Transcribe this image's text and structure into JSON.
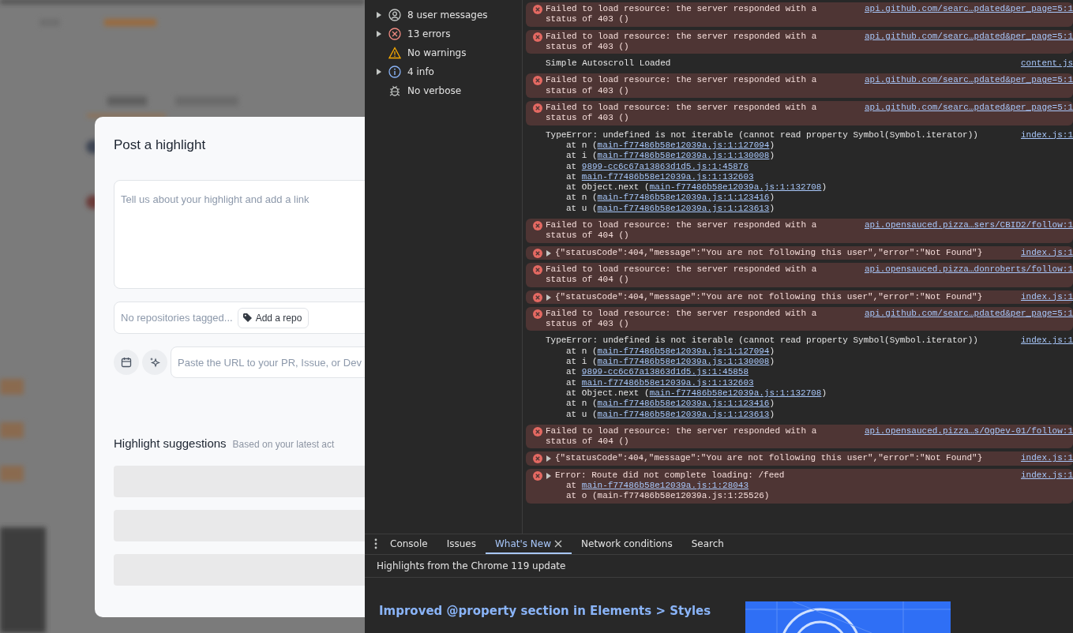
{
  "modal": {
    "title": "Post a highlight",
    "post_field": {
      "placeholder": "Tell us about your highlight and add a link"
    },
    "repo_field": {
      "placeholder": "No repositories tagged..."
    },
    "add_repo_button": "Add a repo",
    "url_field": {
      "placeholder": "Paste the URL to your PR, Issue, or Dev"
    },
    "suggestions": {
      "title": "Highlight suggestions",
      "subtitle": "Based on your latest act",
      "rows": [
        {
          "kind": "skeleton"
        },
        {
          "kind": "skeleton"
        },
        {
          "kind": "skeleton"
        }
      ]
    }
  },
  "sidebar": {
    "items": [
      {
        "label": "8 user messages",
        "kind": "user",
        "expandable": true
      },
      {
        "label": "13 errors",
        "kind": "error",
        "expandable": true
      },
      {
        "label": "No warnings",
        "kind": "warning",
        "expandable": false
      },
      {
        "label": "4 info",
        "kind": "info",
        "expandable": true
      },
      {
        "label": "No verbose",
        "kind": "verbose",
        "expandable": false
      }
    ]
  },
  "console": {
    "messages": [
      {
        "kind": "error",
        "expandable": false,
        "text": "Failed to load resource: the server responded with a status of 403 ()",
        "source": "api.github.com/searc…pdated&per_page=5:1"
      },
      {
        "kind": "error",
        "expandable": false,
        "text": "Failed to load resource: the server responded with a status of 403 ()",
        "source": "api.github.com/searc…pdated&per_page=5:1"
      },
      {
        "kind": "log",
        "expandable": false,
        "text": "Simple Autoscroll Loaded",
        "source": "content.js"
      },
      {
        "kind": "error",
        "expandable": false,
        "text": "Failed to load resource: the server responded with a status of 403 ()",
        "source": "api.github.com/searc…pdated&per_page=5:1"
      },
      {
        "kind": "error",
        "expandable": false,
        "text": "Failed to load resource: the server responded with a status of 403 ()",
        "source": "api.github.com/searc…pdated&per_page=5:1"
      },
      {
        "kind": "log",
        "expandable": false,
        "text": "TypeError: undefined is not iterable (cannot read property Symbol(Symbol.iterator))",
        "source": "index.js:1",
        "stack": [
          {
            "prefix": "at n (",
            "link": "main-f77486b58e12039a.js:1:127094",
            "suffix": ")"
          },
          {
            "prefix": "at i (",
            "link": "main-f77486b58e12039a.js:1:130008",
            "suffix": ")"
          },
          {
            "prefix": "at ",
            "link": "9899-cc6c67a13863d1d5.js:1:45876"
          },
          {
            "prefix": "at ",
            "link": "main-f77486b58e12039a.js:1:132603"
          },
          {
            "prefix": "at Object.next (",
            "link": "main-f77486b58e12039a.js:1:132708",
            "suffix": ")"
          },
          {
            "prefix": "at n (",
            "link": "main-f77486b58e12039a.js:1:123416",
            "suffix": ")"
          },
          {
            "prefix": "at u (",
            "link": "main-f77486b58e12039a.js:1:123613",
            "suffix": ")"
          }
        ]
      },
      {
        "kind": "error",
        "expandable": false,
        "text": "Failed to load resource: the server responded with a status of 404 ()",
        "source": "api.opensauced.pizza…sers/CBID2/follow:1"
      },
      {
        "kind": "error",
        "expandable": true,
        "text": "{\"statusCode\":404,\"message\":\"You are not following this user\",\"error\":\"Not Found\"}",
        "source": "index.js:1"
      },
      {
        "kind": "error",
        "expandable": false,
        "text": "Failed to load resource: the server responded with a status of 404 ()",
        "source": "api.opensauced.pizza…donroberts/follow:1"
      },
      {
        "kind": "error",
        "expandable": true,
        "text": "{\"statusCode\":404,\"message\":\"You are not following this user\",\"error\":\"Not Found\"}",
        "source": "index.js:1"
      },
      {
        "kind": "error",
        "expandable": false,
        "text": "Failed to load resource: the server responded with a status of 403 ()",
        "source": "api.github.com/searc…pdated&per_page=5:1"
      },
      {
        "kind": "log",
        "expandable": false,
        "text": "TypeError: undefined is not iterable (cannot read property Symbol(Symbol.iterator))",
        "source": "index.js:1",
        "stack": [
          {
            "prefix": "at n (",
            "link": "main-f77486b58e12039a.js:1:127094",
            "suffix": ")"
          },
          {
            "prefix": "at i (",
            "link": "main-f77486b58e12039a.js:1:130008",
            "suffix": ")"
          },
          {
            "prefix": "at ",
            "link": "9899-cc6c67a13863d1d5.js:1:45858"
          },
          {
            "prefix": "at ",
            "link": "main-f77486b58e12039a.js:1:132603"
          },
          {
            "prefix": "at Object.next (",
            "link": "main-f77486b58e12039a.js:1:132708",
            "suffix": ")"
          },
          {
            "prefix": "at n (",
            "link": "main-f77486b58e12039a.js:1:123416",
            "suffix": ")"
          },
          {
            "prefix": "at u (",
            "link": "main-f77486b58e12039a.js:1:123613",
            "suffix": ")"
          }
        ]
      },
      {
        "kind": "error",
        "expandable": false,
        "text": "Failed to load resource: the server responded with a status of 404 ()",
        "source": "api.opensauced.pizza…s/OgDev-01/follow:1"
      },
      {
        "kind": "error",
        "expandable": true,
        "text": "{\"statusCode\":404,\"message\":\"You are not following this user\",\"error\":\"Not Found\"}",
        "source": "index.js:1"
      },
      {
        "kind": "error",
        "expandable": true,
        "text": "Error: Route did not complete loading: /feed",
        "source": "index.js:1",
        "stack": [
          {
            "prefix": "at ",
            "link": "main-f77486b58e12039a.js:1:28043"
          },
          {
            "prefix": "at o (main-f77486b58e12039a.js:1:25526)"
          }
        ]
      }
    ]
  },
  "drawer": {
    "tabs": [
      {
        "label": "Console",
        "selected": false,
        "closable": false
      },
      {
        "label": "Issues",
        "selected": false,
        "closable": false
      },
      {
        "label": "What's New",
        "selected": true,
        "closable": true
      },
      {
        "label": "Network conditions",
        "selected": false,
        "closable": false
      },
      {
        "label": "Search",
        "selected": false,
        "closable": false
      }
    ],
    "subtitle": "Highlights from the Chrome 119 update",
    "heading": "Improved @property section in Elements > Styles"
  }
}
